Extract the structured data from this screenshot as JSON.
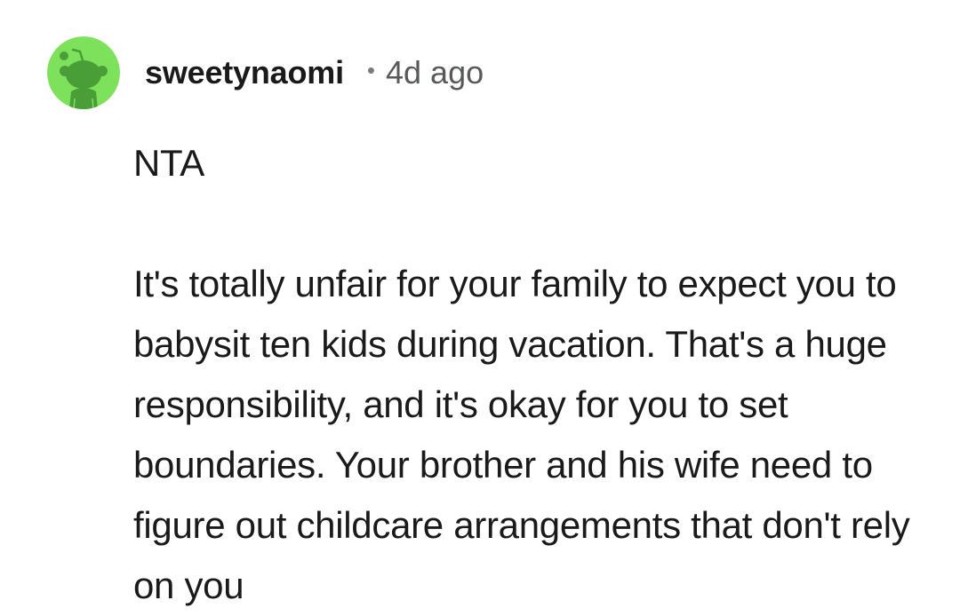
{
  "comment": {
    "author": "sweetynaomi",
    "separator": "•",
    "age": "4d ago",
    "paragraphs": [
      "NTA",
      "It's totally unfair for your family to expect you to babysit ten kids during vacation. That's a huge responsibility, and it's okay for you to set boundaries. Your brother and his wife need to figure out childcare arrangements that don't rely on you"
    ]
  },
  "avatar": {
    "icon": "reddit-snoo-avatar-icon",
    "background": "#7ee15b",
    "figure": "#4a9e38"
  }
}
